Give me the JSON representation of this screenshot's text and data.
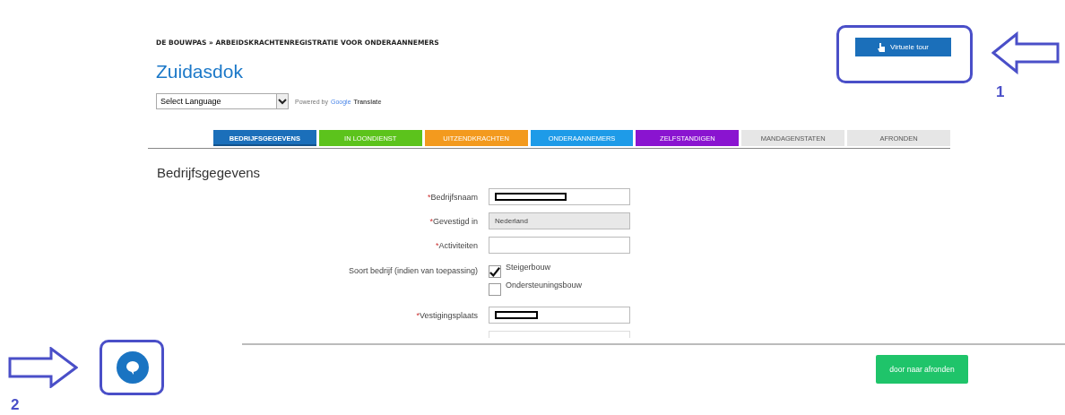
{
  "header": {
    "breadcrumb": "DE BOUWPAS » ARBEIDSKRACHTENREGISTRATIE VOOR ONDERAANNEMERS",
    "title": "Zuidasdok"
  },
  "language": {
    "value": "Select Language",
    "powered_by": "Powered by",
    "google": "Google",
    "translate": "Translate"
  },
  "tour_button": {
    "label": "Virtuele tour"
  },
  "tabs": [
    {
      "label": "BEDRIJFSGEGEVENS",
      "color": "#1b6fba",
      "selected": true
    },
    {
      "label": "IN LOONDIENST",
      "color": "#5cc31c",
      "selected": false
    },
    {
      "label": "UITZENDKRACHTEN",
      "color": "#f39a1e",
      "selected": false
    },
    {
      "label": "ONDERAANNEMERS",
      "color": "#1e9be8",
      "selected": false
    },
    {
      "label": "ZELFSTANDIGEN",
      "color": "#8a14d0",
      "selected": false
    },
    {
      "label": "MANDAGENSTATEN",
      "color": "#e6e6e6",
      "selected": false
    },
    {
      "label": "AFRONDEN",
      "color": "#e6e6e6",
      "selected": false
    }
  ],
  "section_title": "Bedrijfsgegevens",
  "form": [
    {
      "kind": "text",
      "marker": "*",
      "label": "Bedrijfsnaam",
      "redacted": true,
      "disabled": false
    },
    {
      "kind": "text",
      "marker": "*",
      "label": "Gevestigd in",
      "value": "Nederland",
      "disabled": true
    },
    {
      "kind": "text",
      "marker": "*",
      "label": "Activiteiten",
      "disabled": false
    },
    {
      "kind": "checkboxes",
      "label": "Soort bedrijf (indien van toepassing)",
      "options": [
        {
          "label": "Steigerbouw",
          "checked": true
        },
        {
          "label": "Ondersteuningsbouw",
          "checked": false
        }
      ]
    },
    {
      "kind": "text",
      "marker": "*",
      "label": "Vestigingsplaats",
      "redacted": true,
      "disabled": false
    }
  ],
  "footer": {
    "next_button": "door naar afronden"
  },
  "annotations": [
    {
      "number": "1"
    },
    {
      "number": "2"
    }
  ]
}
